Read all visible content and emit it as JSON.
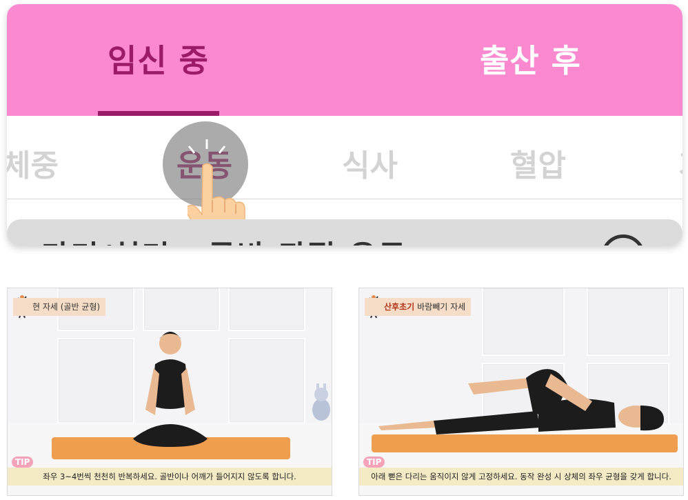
{
  "main_tabs": [
    {
      "label": "임신 중",
      "active": true
    },
    {
      "label": "출산 후",
      "active": false
    }
  ],
  "sub_tabs": [
    {
      "label": "체중",
      "active": false
    },
    {
      "label": "운동",
      "active": true
    },
    {
      "label": "식사",
      "active": false
    },
    {
      "label": "혈압",
      "active": false
    },
    {
      "label": "기",
      "active": false
    }
  ],
  "search": {
    "text": "다리/허리 · 골반 관절 운동",
    "icon": "search-icon"
  },
  "videos": [
    {
      "tag_highlight": "",
      "tag_text": "현 자세 (골반 균형)",
      "tip": "TIP",
      "caption": "좌우 3~4번씩 천천히 반복하세요. 골반이나 어깨가 들어지지 않도록 합니다."
    },
    {
      "tag_highlight": "산후초기",
      "tag_text": "바람빼기 자세",
      "tip": "TIP",
      "caption": "아래 뻗은 다리는 움직이지 않게 고정하세요. 동작 완성 시 상체의 좌우 균형을 갖게 합니다."
    }
  ],
  "colors": {
    "pink": "#fb89d0",
    "accent": "#9b1b66",
    "mat": "#ef9d4f",
    "caption_bg": "#f4eac6"
  }
}
